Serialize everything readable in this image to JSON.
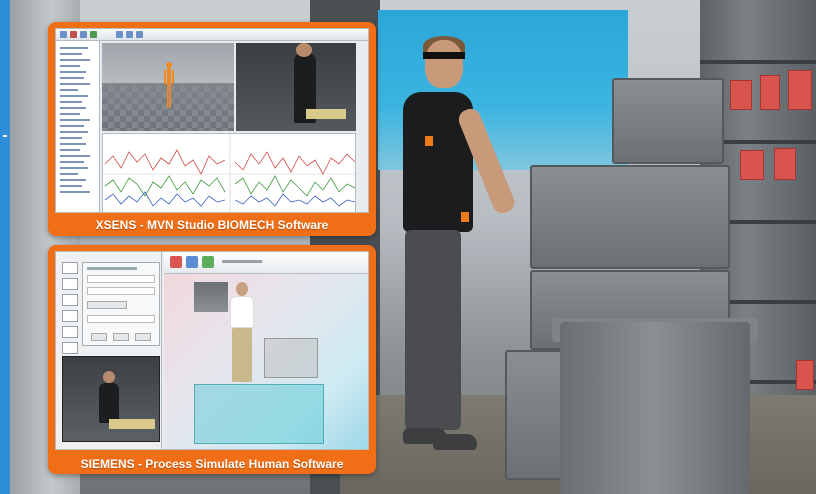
{
  "panels": [
    {
      "caption": "XSENS - MVN Studio BIOMECH Software"
    },
    {
      "caption": "SIEMENS - Process Simulate Human Software"
    }
  ],
  "colors": {
    "panel_orange": "#f06e16",
    "accent_blue": "#2e8fd6",
    "caption_text": "#ffffff"
  }
}
